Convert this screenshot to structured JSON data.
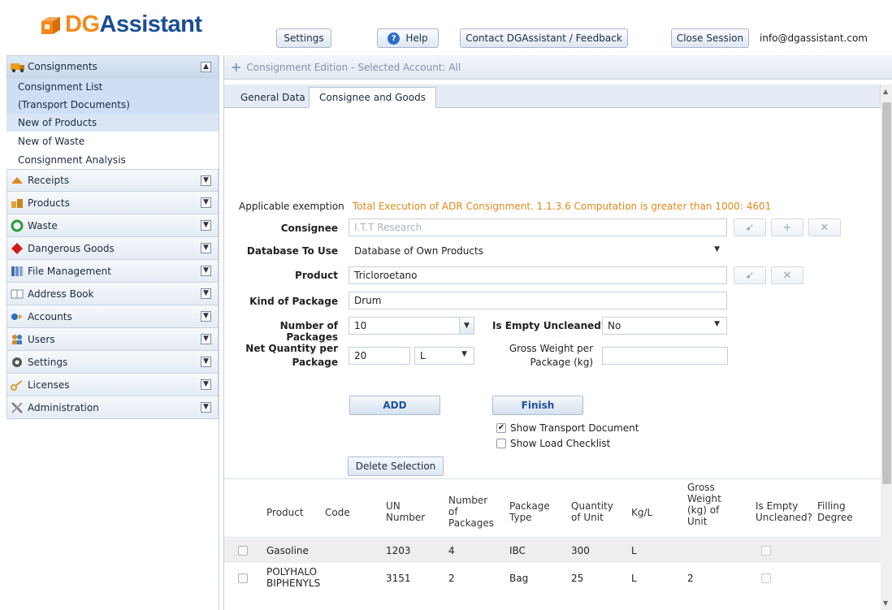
{
  "header": {
    "logo_prefix": "DG",
    "logo_rest": "Assistant",
    "buttons": {
      "settings": "Settings",
      "help": "Help",
      "contact": "Contact DGAssistant / Feedback",
      "close_session": "Close Session"
    },
    "email": "info@dgassistant.com"
  },
  "sidebar": {
    "consignments": {
      "label": "Consignments",
      "items": [
        "Consignment List",
        "(Transport Documents)",
        "New of Products",
        "New of Waste",
        "Consignment Analysis"
      ]
    },
    "sections": [
      {
        "label": "Receipts",
        "icon": "receipt-icon"
      },
      {
        "label": "Products",
        "icon": "products-icon"
      },
      {
        "label": "Waste",
        "icon": "recycle-icon"
      },
      {
        "label": "Dangerous Goods",
        "icon": "diamond-icon"
      },
      {
        "label": "File Management",
        "icon": "files-icon"
      },
      {
        "label": "Address Book",
        "icon": "address-book-icon"
      },
      {
        "label": "Accounts",
        "icon": "accounts-icon"
      },
      {
        "label": "Users",
        "icon": "users-icon"
      },
      {
        "label": "Settings",
        "icon": "gear-icon"
      },
      {
        "label": "Licenses",
        "icon": "key-icon"
      },
      {
        "label": "Administration",
        "icon": "tools-icon"
      }
    ]
  },
  "panel": {
    "title": "Consignment Edition - Selected Account: All",
    "tabs": [
      "General Data",
      "Consignee and Goods"
    ],
    "active_tab": "Consignee and Goods"
  },
  "form": {
    "exemption_label": "Applicable exemption",
    "exemption_value": "Total Execution of ADR Consignment. 1.1.3.6 Computation is greater than 1000: 4601",
    "consignee_label": "Consignee",
    "consignee_value": "I.T.T Research",
    "database_label": "Database To Use",
    "database_value": "Database of Own Products",
    "product_label": "Product",
    "product_value": "Tricloroetano",
    "package_kind_label": "Kind of Package",
    "package_kind_value": "Drum",
    "num_packages_label": "Number of Packages",
    "num_packages_value": "10",
    "empty_uncleaned_label": "Is Empty Uncleaned?",
    "empty_uncleaned_value": "No",
    "net_qty_label_1": "Net Quantity per",
    "net_qty_label_2": "Package",
    "net_qty_value": "20",
    "net_qty_unit": "L",
    "gross_weight_label_1": "Gross Weight per",
    "gross_weight_label_2": "Package (kg)",
    "gross_weight_value": "",
    "add_button": "ADD",
    "finish_button": "Finish",
    "show_transport_doc": "Show Transport Document",
    "show_transport_doc_checked": true,
    "show_load_checklist": "Show Load Checklist",
    "show_load_checklist_checked": false,
    "delete_selection": "Delete Selection"
  },
  "grid": {
    "headers": {
      "product": "Product",
      "code": "Code",
      "un_1": "UN",
      "un_2": "Number",
      "num_1": "Number",
      "num_2": "of",
      "num_3": "Packages",
      "pkg_1": "Package",
      "pkg_2": "Type",
      "qty_1": "Quantity",
      "qty_2": "of Unit",
      "kgl": "Kg/L",
      "gw_1": "Gross",
      "gw_2": "Weight",
      "gw_3": "(kg) of",
      "gw_4": "Unit",
      "empty_1": "Is Empty",
      "empty_2": "Uncleaned?",
      "fill_1": "Filling",
      "fill_2": "Degree"
    },
    "rows": [
      {
        "product_1": "Gasoline",
        "product_2": "",
        "code": "",
        "un": "1203",
        "packages": "4",
        "type": "IBC",
        "qty": "300",
        "unit": "L",
        "gross": "",
        "fill": ""
      },
      {
        "product_1": "POLYHALO",
        "product_2": "BIPHENYLS",
        "code": "",
        "un": "3151",
        "packages": "2",
        "type": "Bag",
        "qty": "25",
        "unit": "L",
        "gross": "2",
        "fill": ""
      }
    ]
  }
}
